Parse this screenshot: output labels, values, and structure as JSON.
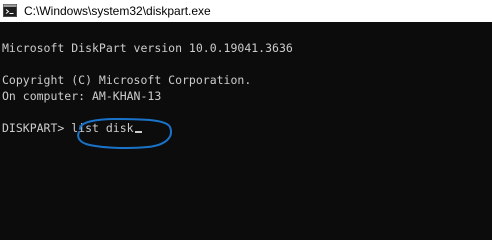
{
  "window": {
    "title": "C:\\Windows\\system32\\diskpart.exe",
    "icon": "console-app-icon"
  },
  "console": {
    "version_line": "Microsoft DiskPart version 10.0.19041.3636",
    "copyright_line": "Copyright (C) Microsoft Corporation.",
    "computer_line": "On computer: AM-KHAN-13",
    "prompt": "DISKPART> ",
    "command": "list disk"
  },
  "colors": {
    "background": "#0c0c0c",
    "text": "#cccccc",
    "annotation": "#1a73c9"
  }
}
